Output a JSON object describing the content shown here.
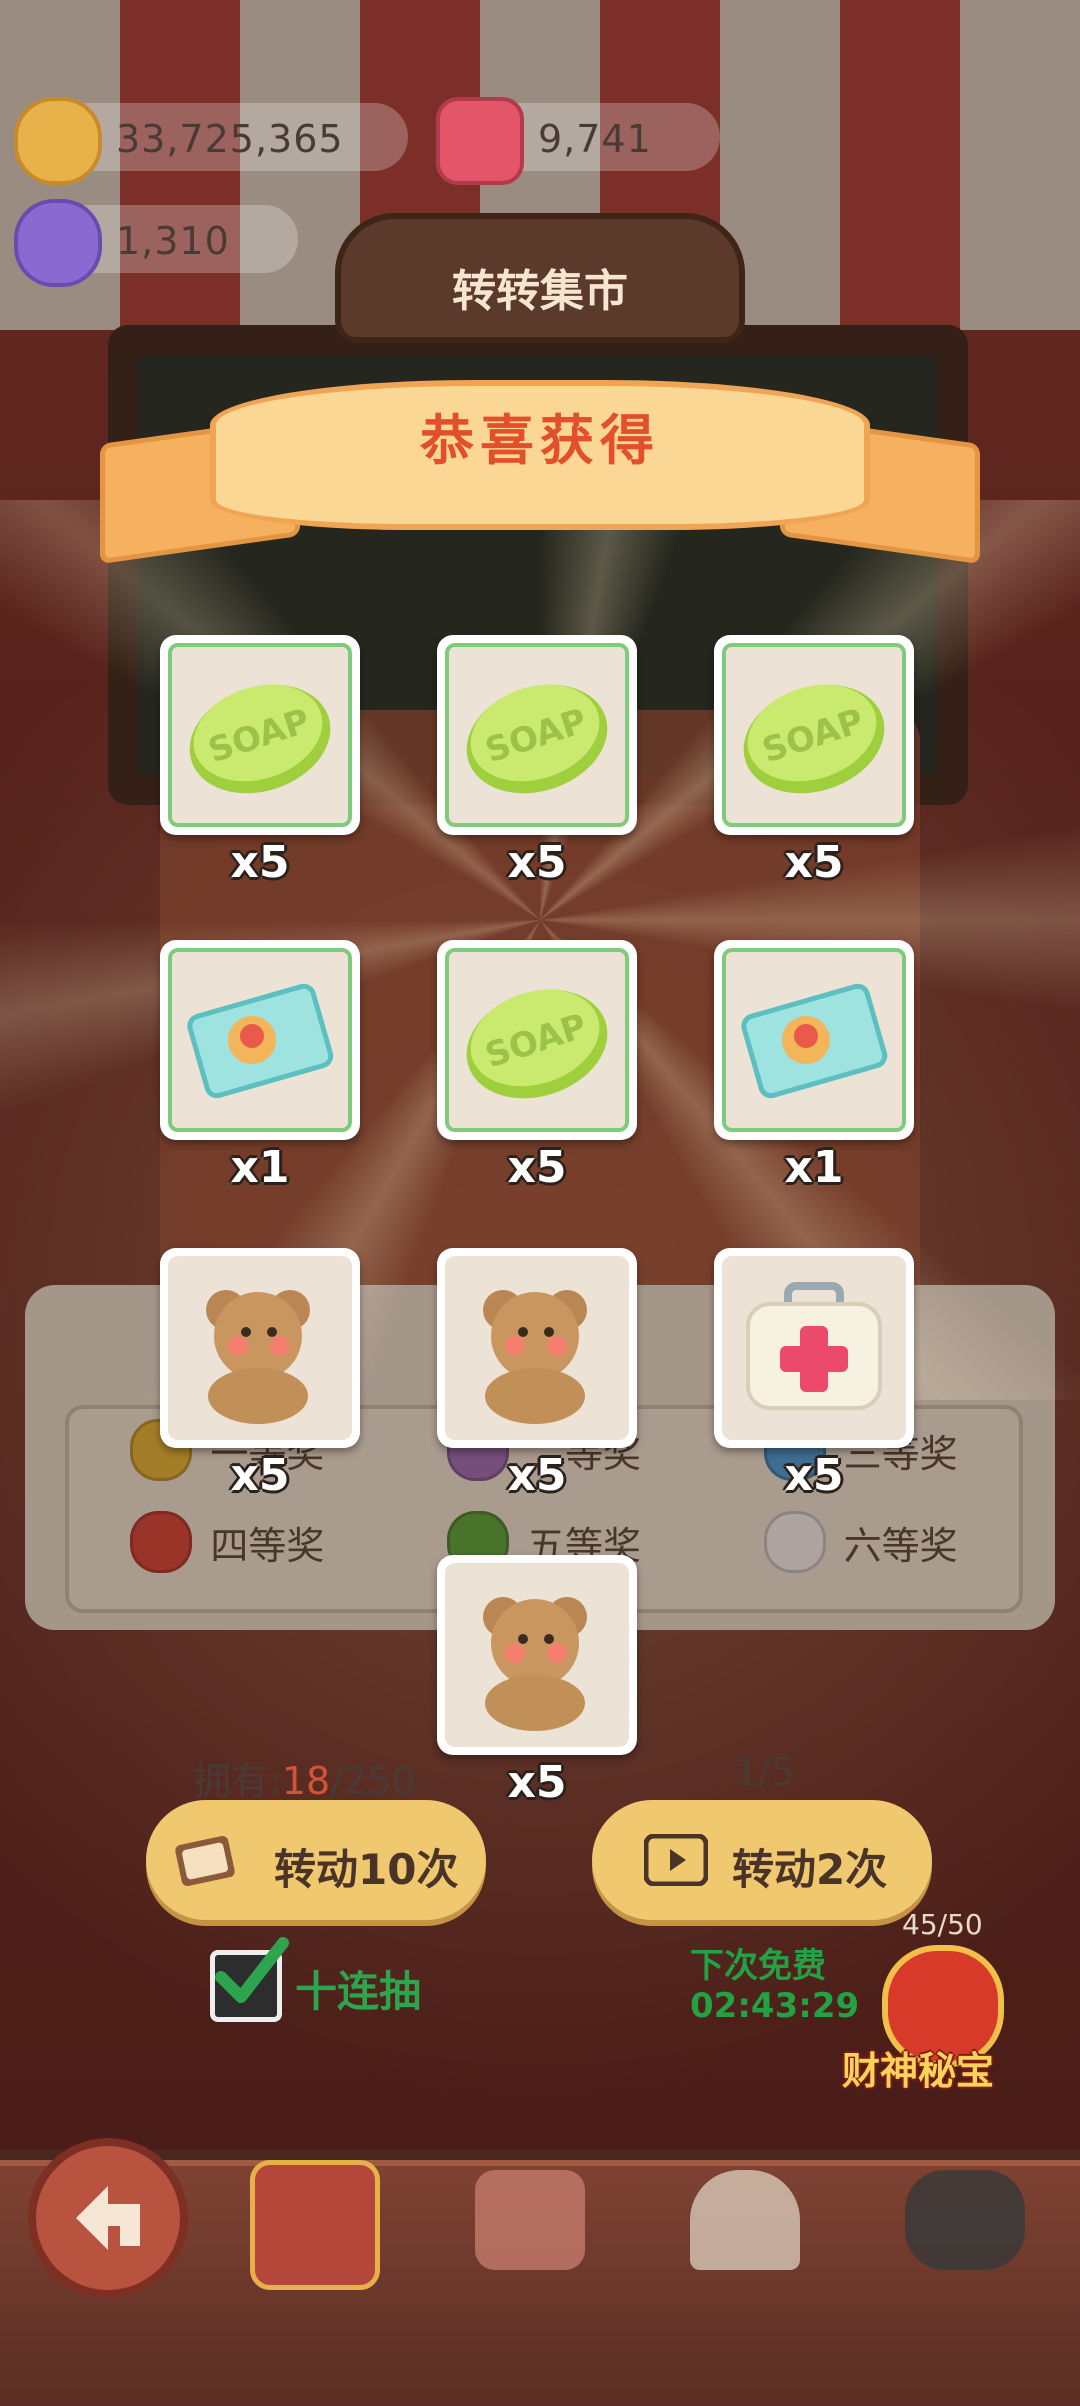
{
  "currency": {
    "coins": "33,725,365",
    "gems": "9,741",
    "candy": "1,310"
  },
  "market_title": "转转集市",
  "banner_title": "恭喜获得",
  "rewards": [
    {
      "item": "soap-icon",
      "qty": "x5"
    },
    {
      "item": "soap-icon",
      "qty": "x5"
    },
    {
      "item": "soap-icon",
      "qty": "x5"
    },
    {
      "item": "ticket-icon",
      "qty": "x1"
    },
    {
      "item": "soap-icon",
      "qty": "x5"
    },
    {
      "item": "ticket-icon",
      "qty": "x1"
    },
    {
      "item": "teddy-bear-icon",
      "qty": "x5"
    },
    {
      "item": "teddy-bear-icon",
      "qty": "x5"
    },
    {
      "item": "first-aid-kit-icon",
      "qty": "x5"
    },
    {
      "item": "teddy-bear-icon",
      "qty": "x5"
    }
  ],
  "prize_tiers": [
    "一等奖",
    "二等奖",
    "三等奖",
    "四等奖",
    "五等奖",
    "六等奖"
  ],
  "owned": {
    "label": "拥有:",
    "current": "18",
    "total": "/250"
  },
  "page": "1/5",
  "buttons": {
    "spin10": "转动10次",
    "spin2": "转动2次"
  },
  "ten_draw": "十连抽",
  "next_free": {
    "label": "下次免费",
    "time": "02:43:29"
  },
  "god_event": {
    "count": "45/50",
    "label": "财神秘宝"
  },
  "colors": {
    "banner_text": "#e1502a",
    "green_text": "#23a243",
    "owned_num": "#d2533a"
  }
}
